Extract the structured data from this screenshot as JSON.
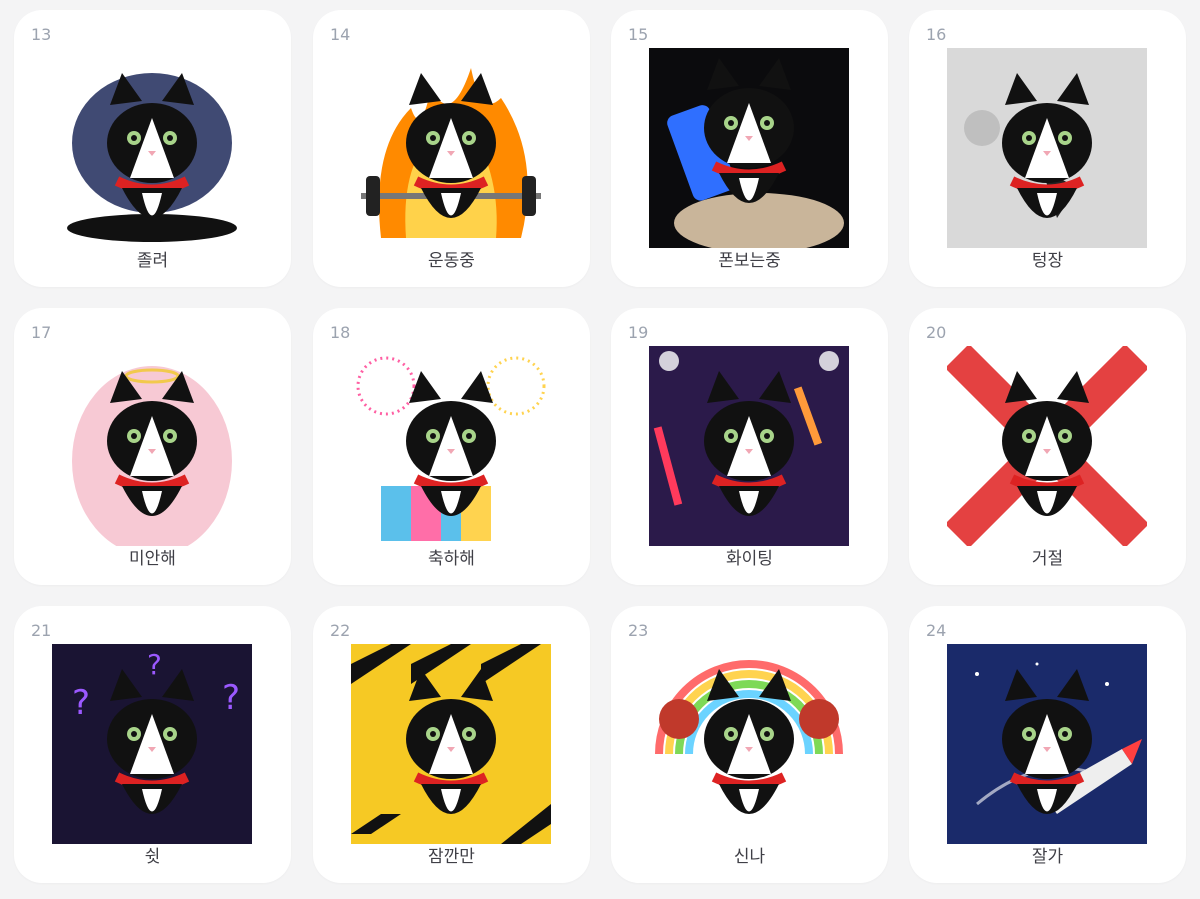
{
  "stickers": [
    {
      "number": "13",
      "label": "졸려",
      "icon": "sleepy-cat-icon",
      "bg": "#ffffff",
      "colors": [
        "#1e2a5a",
        "#4b5fa0"
      ]
    },
    {
      "number": "14",
      "label": "운동중",
      "icon": "workout-cat-icon",
      "bg": "#ffffff",
      "colors": [
        "#ff8a00",
        "#ffd24a"
      ]
    },
    {
      "number": "15",
      "label": "폰보는중",
      "icon": "phone-cat-icon",
      "bg": "#0b0b0d",
      "colors": [
        "#1c2a44",
        "#2f6fff"
      ]
    },
    {
      "number": "16",
      "label": "텅장",
      "icon": "empty-wallet-cat-icon",
      "bg": "#d9d9d9",
      "colors": [
        "#bfbfbf",
        "#f0f0f0"
      ]
    },
    {
      "number": "17",
      "label": "미안해",
      "icon": "sorry-cat-icon",
      "bg": "#ffffff",
      "colors": [
        "#f7c9d4",
        "#fbe8ee"
      ]
    },
    {
      "number": "18",
      "label": "축하해",
      "icon": "congrats-cat-icon",
      "bg": "#ffffff",
      "colors": [
        "#ff5fa3",
        "#ffd34f"
      ]
    },
    {
      "number": "19",
      "label": "화이팅",
      "icon": "cheering-cat-icon",
      "bg": "#2b1a4a",
      "colors": [
        "#7a2fd0",
        "#ff3a5c"
      ]
    },
    {
      "number": "20",
      "label": "거절",
      "icon": "refusal-cat-icon",
      "bg": "#ffffff",
      "colors": [
        "#e02020",
        "#ff6b6b"
      ]
    },
    {
      "number": "21",
      "label": "쉿",
      "icon": "shush-cat-icon",
      "bg": "#1a1433",
      "colors": [
        "#2a2250",
        "#9b59ff"
      ]
    },
    {
      "number": "22",
      "label": "잠깐만",
      "icon": "wait-cat-icon",
      "bg": "#f6c924",
      "colors": [
        "#111111",
        "#f6c924"
      ]
    },
    {
      "number": "23",
      "label": "신나",
      "icon": "excited-cat-icon",
      "bg": "#ffffff",
      "colors": [
        "#ff6b6b",
        "#6bd3ff"
      ]
    },
    {
      "number": "24",
      "label": "잘가",
      "icon": "goodbye-rocket-cat-icon",
      "bg": "#1a2a6a",
      "colors": [
        "#2a3f8f",
        "#ff4040"
      ]
    }
  ]
}
